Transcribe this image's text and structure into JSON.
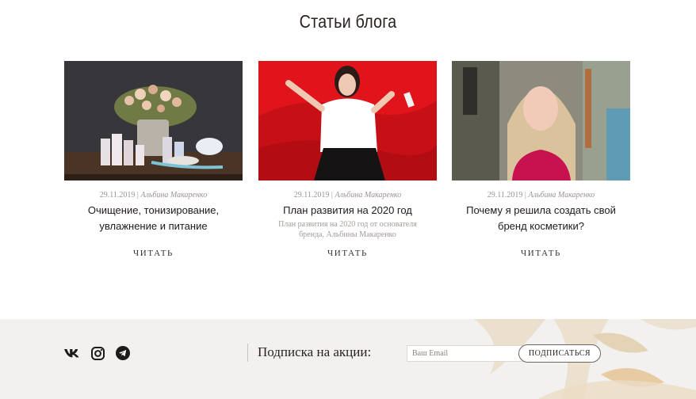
{
  "section": {
    "title": "Статьи блога"
  },
  "posts": [
    {
      "date": "29.11.2019",
      "separator": " | ",
      "author": "Альбина Макаренко",
      "title": "Очищение, тонизирование, увлажнение и питание",
      "excerpt": "",
      "read_label": "ЧИТАТЬ"
    },
    {
      "date": "29.11.2019",
      "separator": " | ",
      "author": "Альбина Макаренко",
      "title": "План развития на 2020 год",
      "excerpt": "План развития на 2020 год от основателя бренда, Альбины Макаренко",
      "read_label": "ЧИТАТЬ"
    },
    {
      "date": "29.11.2019",
      "separator": " | ",
      "author": "Альбина Макаренко",
      "title": "Почему я решила создать свой бренд косметики?",
      "excerpt": "",
      "read_label": "ЧИТАТЬ"
    }
  ],
  "footer": {
    "social": [
      "vk-icon",
      "instagram-icon",
      "telegram-icon"
    ],
    "subscribe_label": "Подписка на акции:",
    "email_placeholder": "Ваш Email",
    "subscribe_button": "ПОДПИСАТЬСЯ"
  }
}
